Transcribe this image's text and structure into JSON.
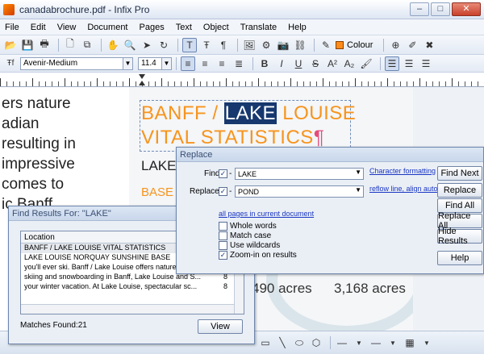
{
  "window": {
    "title": "canadabrochure.pdf - Infix Pro",
    "min": "–",
    "max": "□",
    "close": "✕"
  },
  "menu": [
    "File",
    "Edit",
    "View",
    "Document",
    "Pages",
    "Text",
    "Object",
    "Translate",
    "Help"
  ],
  "toolbar": {
    "colour_label": "Colour"
  },
  "format": {
    "font": "Avenir-Medium",
    "size": "11.4"
  },
  "document": {
    "left_lines": [
      "ers nature",
      "adian",
      "resulting in",
      "impressive",
      "comes to",
      "ic Banff"
    ],
    "headline_pre": "BANFF / ",
    "headline_sel": "LAKE",
    "headline_post": " LOUISE",
    "headline_line2": "VITAL STATISTICS",
    "pilcrow": "¶",
    "lake": "LAKE",
    "base": "BASE",
    "acres1": "490 acres",
    "acres2": "3,168 acres"
  },
  "find_results": {
    "title": "Find Results For: \"LAKE\"",
    "column": "Location",
    "rows": [
      {
        "text": "BANFF / LAKE LOUISE VITAL STATISTICS",
        "count": ""
      },
      {
        "text": "LAKE LOUISE NORQUAY SUNSHINE BASE",
        "count": ""
      },
      {
        "text": "you'll ever ski. Banff / Lake Louise offers nature and",
        "count": ""
      },
      {
        "text": "skiing and snowboarding in Banff, Lake Louise and S...",
        "count": "8"
      },
      {
        "text": "your winter vacation. At Lake Louise, spectacular sc...",
        "count": "8"
      },
      {
        "text": "",
        "count": ""
      }
    ],
    "matches": "Matches Found:21",
    "view_button": "View"
  },
  "replace": {
    "title": "Replace",
    "find_label": "Find:",
    "find_value": "LAKE",
    "replace_label": "Replace:",
    "replace_value": "POND",
    "char_fmt_link": "Character formatting",
    "reflow_link": "reflow line, align auto",
    "scope_link": "all pages in current document",
    "options": [
      {
        "label": "Whole words",
        "checked": false
      },
      {
        "label": "Match case",
        "checked": false
      },
      {
        "label": "Use wildcards",
        "checked": false
      },
      {
        "label": "Zoom-in on results",
        "checked": true
      }
    ],
    "buttons": {
      "find_next": "Find Next",
      "replace": "Replace",
      "find_all": "Find All",
      "replace_all": "Replace All",
      "hide_results": "Hide Results",
      "help": "Help"
    }
  }
}
